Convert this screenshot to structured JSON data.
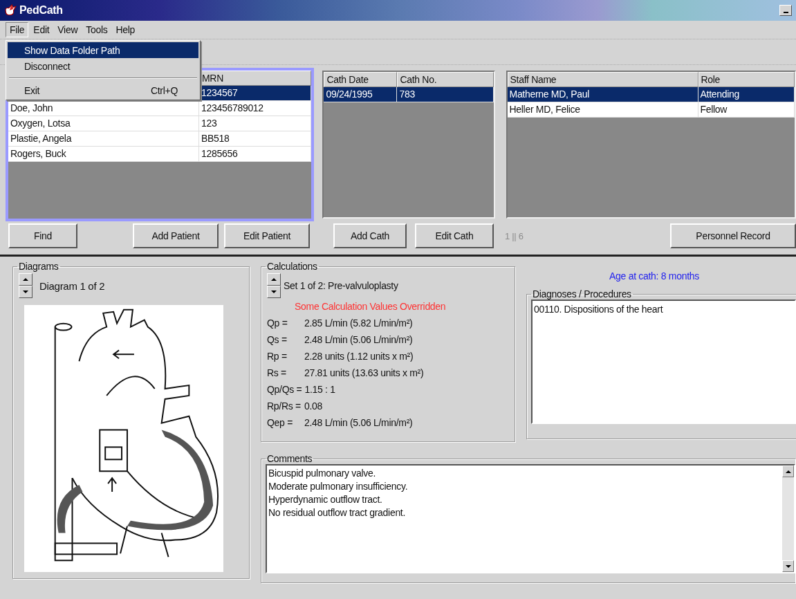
{
  "window": {
    "title": "PedCath"
  },
  "menu_bar": [
    {
      "label": "File",
      "selected": true
    },
    {
      "label": "Edit",
      "selected": false
    },
    {
      "label": "View",
      "selected": false
    },
    {
      "label": "Tools",
      "selected": false
    },
    {
      "label": "Help",
      "selected": false
    }
  ],
  "file_menu": [
    {
      "kind": "item",
      "label": "Show Data Folder Path",
      "selected": true
    },
    {
      "kind": "item",
      "label": "Disconnect",
      "selected": false
    },
    {
      "kind": "separator"
    },
    {
      "kind": "item",
      "label": "Exit",
      "shortcut": "Ctrl+Q",
      "selected": false
    }
  ],
  "patients": {
    "mrn_header": "MRN",
    "rows": [
      {
        "mrn": "1234567",
        "selected": true
      },
      {
        "name": "Doe, John",
        "mrn": "123456789012",
        "selected": false
      },
      {
        "name": "Oxygen, Lotsa",
        "mrn": "123",
        "selected": false
      },
      {
        "name": "Plastie, Angela",
        "mrn": "BB518",
        "selected": false
      },
      {
        "name": "Rogers, Buck",
        "mrn": "1285656",
        "selected": false
      }
    ]
  },
  "caths": {
    "columns": [
      "Cath Date",
      "Cath No."
    ],
    "rows": [
      {
        "cells": [
          "09/24/1995",
          "783"
        ],
        "selected": true
      }
    ]
  },
  "staff": {
    "columns": [
      "Staff Name",
      "Role"
    ],
    "rows": [
      {
        "cells": [
          "Matherne MD, Paul",
          "Attending"
        ],
        "selected": true
      },
      {
        "cells": [
          "Heller MD, Felice",
          "Fellow"
        ],
        "selected": false
      }
    ]
  },
  "patient_buttons": [
    "Find",
    "Add Patient",
    "Edit Patient"
  ],
  "cath_buttons": [
    "Add Cath",
    "Edit Cath"
  ],
  "record_counter": "1 || 6",
  "personnel_button": "Personnel Record",
  "diagrams": {
    "title": "Diagrams",
    "caption": "Diagram 1 of 2"
  },
  "calculations": {
    "title": "Calculations",
    "set_label": "Set 1 of 2: Pre-valvuloplasty",
    "warning": "Some Calculation Values Overridden",
    "rows": [
      {
        "label": "Qp =",
        "value": "2.85 L/min (5.82 L/min/m²)"
      },
      {
        "label": "Qs =",
        "value": "2.48 L/min (5.06 L/min/m²)"
      },
      {
        "label": "Rp =",
        "value": "2.28 units (1.12 units x m²)"
      },
      {
        "label": "Rs =",
        "value": "27.81 units (13.63 units x m²)"
      },
      {
        "label": "Qp/Qs =",
        "value": "1.15  : 1"
      },
      {
        "label": "Rp/Rs =",
        "value": "0.08"
      },
      {
        "label": "Qep =",
        "value": "2.48 L/min (5.06 L/min/m²)"
      }
    ]
  },
  "age_at_cath": "Age at cath: 8 months",
  "diagnoses": {
    "title": "Diagnoses / Procedures",
    "items": [
      "00110. Dispositions of the heart"
    ]
  },
  "comments": {
    "title": "Comments",
    "lines": [
      "Bicuspid pulmonary valve.",
      "Moderate pulmonary insufficiency.",
      "Hyperdynamic outflow tract.",
      "No residual outflow tract gradient."
    ]
  }
}
